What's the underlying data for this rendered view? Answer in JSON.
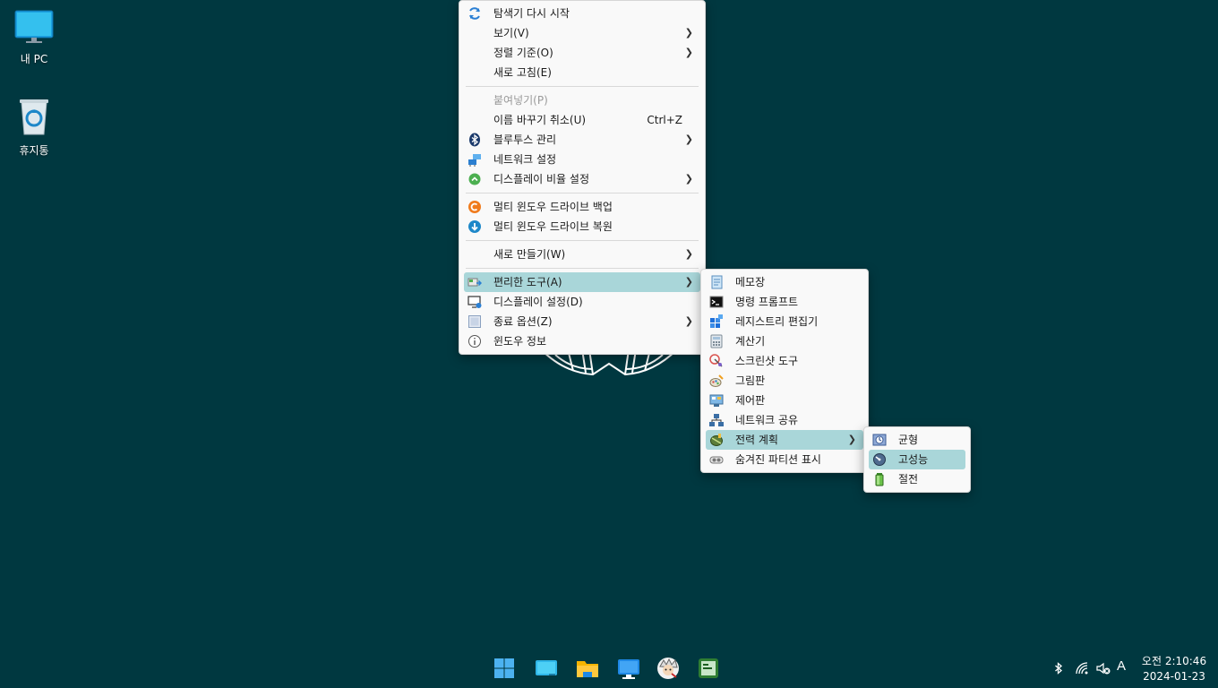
{
  "desktop": {
    "icons": [
      {
        "label": "내 PC",
        "icon": "monitor-icon"
      },
      {
        "label": "휴지통",
        "icon": "recycle-bin-icon"
      }
    ]
  },
  "main_menu": {
    "items": [
      {
        "label": "탐색기 다시 시작",
        "icon": "refresh-icon"
      },
      {
        "label": "보기(V)",
        "submenu": true
      },
      {
        "label": "정렬 기준(O)",
        "submenu": true
      },
      {
        "label": "새로 고침(E)"
      },
      {
        "label": "붙여넣기(P)",
        "disabled": true
      },
      {
        "label": "이름 바꾸기 취소(U)",
        "shortcut": "Ctrl+Z"
      },
      {
        "label": "블루투스 관리",
        "icon": "bluetooth-icon",
        "submenu": true
      },
      {
        "label": "네트워크 설정",
        "icon": "network-icon"
      },
      {
        "label": "디스플레이 비율 설정",
        "icon": "scale-icon",
        "submenu": true
      },
      {
        "label": "멀티 윈도우 드라이브 백업",
        "icon": "backup-icon"
      },
      {
        "label": "멀티 윈도우 드라이브 복원",
        "icon": "restore-icon"
      },
      {
        "label": "새로 만들기(W)",
        "submenu": true
      },
      {
        "label": "편리한 도구(A)",
        "icon": "tools-icon",
        "submenu": true,
        "highlighted": true
      },
      {
        "label": "디스플레이 설정(D)",
        "icon": "display-settings-icon"
      },
      {
        "label": "종료 옵션(Z)",
        "icon": "power-options-icon",
        "submenu": true
      },
      {
        "label": "윈도우 정보",
        "icon": "info-icon"
      }
    ]
  },
  "tools_menu": {
    "items": [
      {
        "label": "메모장",
        "icon": "notepad-icon"
      },
      {
        "label": "명령 프롬프트",
        "icon": "cmd-icon"
      },
      {
        "label": "레지스트리 편집기",
        "icon": "registry-icon"
      },
      {
        "label": "계산기",
        "icon": "calculator-icon"
      },
      {
        "label": "스크린샷 도구",
        "icon": "snipping-icon"
      },
      {
        "label": "그림판",
        "icon": "paint-icon"
      },
      {
        "label": "제어판",
        "icon": "control-panel-icon"
      },
      {
        "label": "네트워크 공유",
        "icon": "network-share-icon"
      },
      {
        "label": "전력 계획",
        "icon": "power-plan-icon",
        "submenu": true,
        "highlighted": true
      },
      {
        "label": "숨겨진 파티션 표시",
        "icon": "hidden-partition-icon"
      }
    ]
  },
  "power_menu": {
    "items": [
      {
        "label": "균형",
        "icon": "balanced-icon"
      },
      {
        "label": "고성능",
        "icon": "high-performance-icon",
        "highlighted": true
      },
      {
        "label": "절전",
        "icon": "power-saver-icon"
      }
    ]
  },
  "taskbar": {
    "buttons": [
      "start-icon",
      "desktop-icon",
      "file-explorer-icon",
      "remote-desktop-icon",
      "avatar-app-icon",
      "terminal-app-icon"
    ],
    "tray": {
      "ime": "A",
      "time": "오전 2:10:46",
      "date": "2024-01-23"
    }
  },
  "colors": {
    "desktop_bg": "#003840",
    "menu_bg": "#f9f9f9",
    "highlight": "#a9d6d9"
  }
}
